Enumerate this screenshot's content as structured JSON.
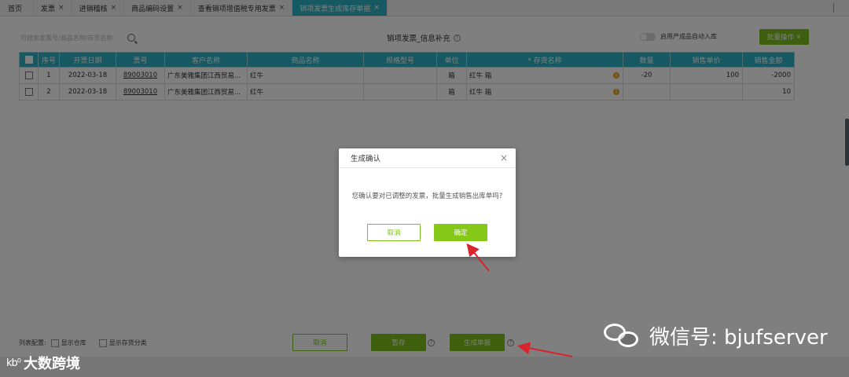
{
  "tabs": [
    {
      "label": "首页",
      "closable": false,
      "active": false
    },
    {
      "label": "发票",
      "closable": true,
      "active": false
    },
    {
      "label": "进销稽核",
      "closable": true,
      "active": false
    },
    {
      "label": "商品编码设置",
      "closable": true,
      "active": false
    },
    {
      "label": "查看销项增值税专用发票",
      "closable": true,
      "active": false
    },
    {
      "label": "销项发票生成库存单据",
      "closable": true,
      "active": true
    }
  ],
  "close_glyph": "×",
  "toolbar": {
    "search_placeholder": "可搜索发票号/商品名称/存货名称",
    "title": "销项发票_信息补充",
    "help_glyph": "?",
    "toggle_label": "启用产成品自动入库",
    "batch_label": "批量操作",
    "batch_arrow": "∨"
  },
  "table": {
    "headers": [
      "序号",
      "开票日期",
      "票号",
      "客户名称",
      "商品名称",
      "规格型号",
      "单位",
      "* 存货名称",
      "数量",
      "销售单价",
      "销售金额"
    ],
    "rows": [
      {
        "seq": "1",
        "date": "2022-03-18",
        "invoice_no": "89003010",
        "customer": "广东美雅集团江西贸易...",
        "product": "红牛",
        "spec": "",
        "unit": "箱",
        "stock": "红牛 箱",
        "qty": "-20",
        "price": "100",
        "amount": "-2000"
      },
      {
        "seq": "2",
        "date": "2022-03-18",
        "invoice_no": "89003010",
        "customer": "广东美雅集团江西贸易...",
        "product": "红牛",
        "spec": "",
        "unit": "箱",
        "stock": "红牛 箱",
        "qty": "",
        "price": "",
        "amount": "10"
      }
    ],
    "warn_glyph": "!"
  },
  "footer": {
    "config_label": "列表配置:",
    "show_warehouse": "显示仓库",
    "show_category": "显示存货分类",
    "cancel_label": "取消",
    "save_label": "暂存",
    "generate_label": "生成单据"
  },
  "dialog": {
    "title": "生成确认",
    "close_glyph": "×",
    "message": "您确认要对已调整的发票，批量生成销售出库单吗?",
    "cancel_label": "取消",
    "ok_label": "确定"
  },
  "watermarks": {
    "left_logo": "kb⁰",
    "left_text": "大数跨境",
    "right_text": "微信号: bjufserver"
  },
  "colors": {
    "accent": "#2cb3c5",
    "green": "#7dbe1c",
    "arrow": "#d9232d",
    "warn": "#e6a019"
  }
}
